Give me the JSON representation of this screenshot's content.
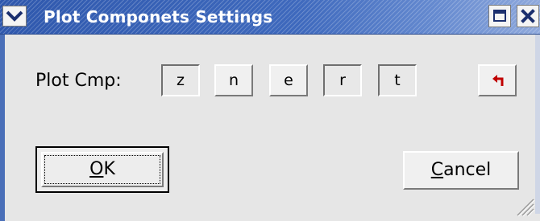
{
  "window": {
    "title": "Plot Componets Settings",
    "title_bar_color": "#3e69bd",
    "icons": [
      "chevron-down-icon",
      "maximize-icon",
      "close-icon"
    ]
  },
  "plot_cmp": {
    "label_prefix": "Plot Cmp",
    "label_suffix": ":",
    "buttons": [
      {
        "label": "z",
        "pressed": true
      },
      {
        "label": "n",
        "pressed": false
      },
      {
        "label": "e",
        "pressed": false
      },
      {
        "label": "r",
        "pressed": true
      },
      {
        "label": "t",
        "pressed": true
      }
    ],
    "undo_icon": "undo-arrow-icon",
    "undo_color": "#c00000"
  },
  "actions": {
    "ok": {
      "mnemonic": "O",
      "rest": "K"
    },
    "cancel": {
      "mnemonic": "C",
      "rest": "ancel"
    }
  }
}
